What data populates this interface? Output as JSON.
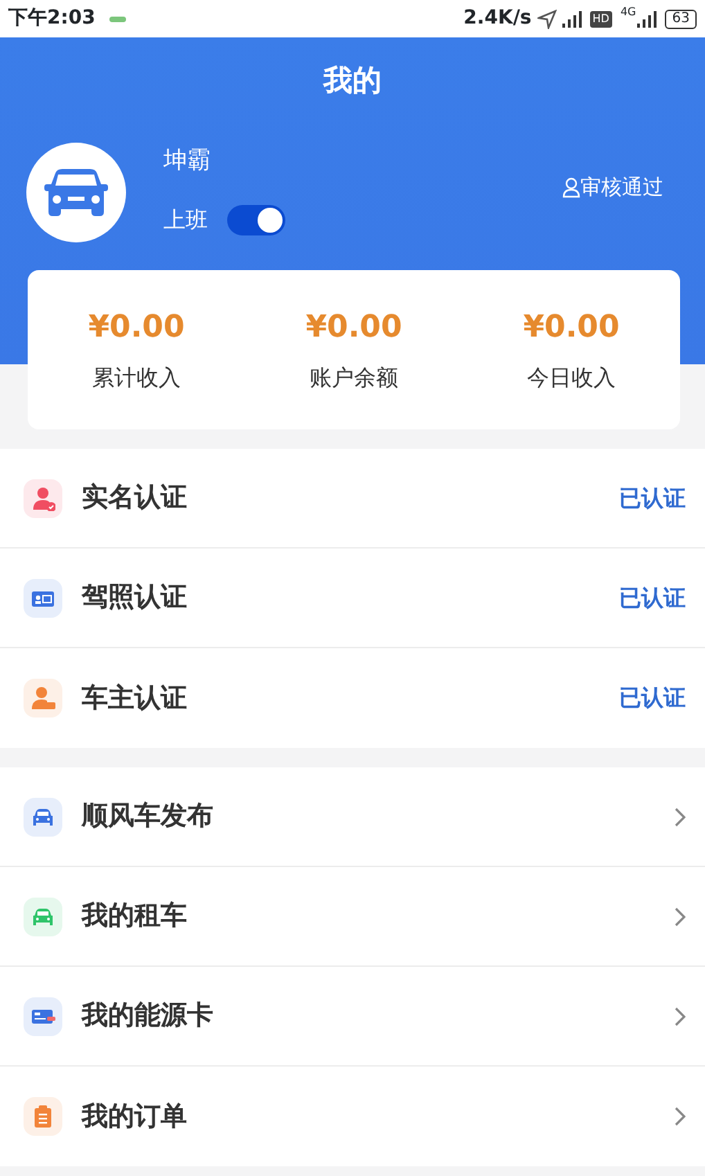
{
  "status_bar": {
    "time": "下午2:03",
    "speed": "2.4K/s",
    "hd": "HD",
    "network": "4G",
    "battery": "63"
  },
  "header": {
    "title": "我的"
  },
  "profile": {
    "name": "坤霸",
    "duty_label": "上班",
    "on_duty": true,
    "review_status": "审核通过"
  },
  "summary": [
    {
      "amount": "¥0.00",
      "label": "累计收入"
    },
    {
      "amount": "¥0.00",
      "label": "账户余额"
    },
    {
      "amount": "¥0.00",
      "label": "今日收入"
    }
  ],
  "sections": [
    {
      "items": [
        {
          "label": "实名认证",
          "kind": "status",
          "status": "已认证",
          "color": "#f04e62"
        },
        {
          "label": "驾照认证",
          "kind": "status",
          "status": "已认证",
          "color": "#3b72e0"
        },
        {
          "label": "车主认证",
          "kind": "status",
          "status": "已认证",
          "color": "#f2843a"
        }
      ]
    },
    {
      "items": [
        {
          "label": "顺风车发布",
          "kind": "link",
          "color": "#3b72e0"
        },
        {
          "label": "我的租车",
          "kind": "link",
          "color": "#2fc46a"
        },
        {
          "label": "我的能源卡",
          "kind": "link",
          "color": "#3b72e0"
        },
        {
          "label": "我的订单",
          "kind": "link",
          "color": "#f2843a"
        }
      ]
    }
  ]
}
